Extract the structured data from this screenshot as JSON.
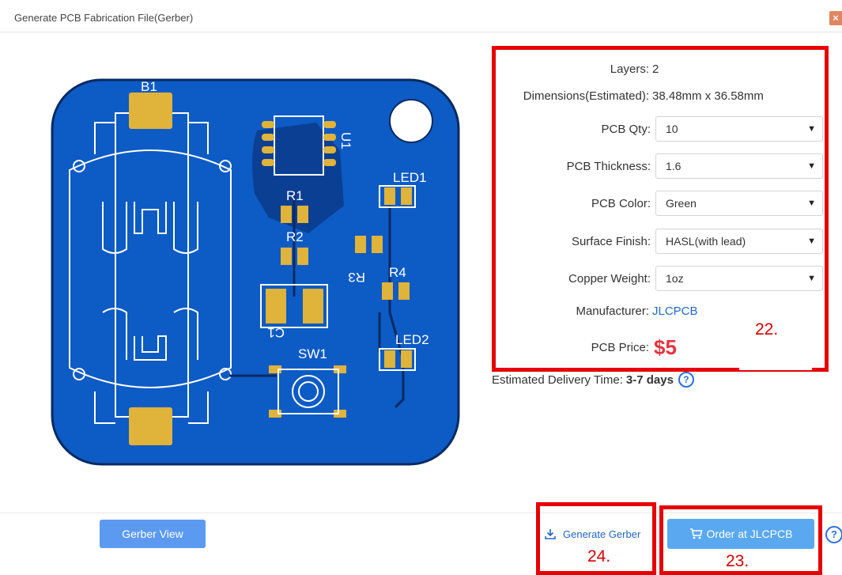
{
  "dialog": {
    "title": "Generate PCB Fabrication File(Gerber)",
    "close_symbol": "×"
  },
  "pcb_preview": {
    "labels": [
      "B1",
      "U1",
      "LED1",
      "R1",
      "R2",
      "R3",
      "R4",
      "C1",
      "SW1",
      "LED2"
    ],
    "board_color": "#0d5bc4",
    "pad_color": "#e0b33a"
  },
  "info": {
    "layers_label": "Layers:",
    "layers_value": "2",
    "dimensions_label": "Dimensions(Estimated):",
    "dimensions_value": "38.48mm x 36.58mm",
    "qty_label": "PCB Qty:",
    "qty_value": "10",
    "thickness_label": "PCB Thickness:",
    "thickness_value": "1.6",
    "color_label": "PCB Color:",
    "color_value": "Green",
    "finish_label": "Surface Finish:",
    "finish_value": "HASL(with lead)",
    "copper_label": "Copper Weight:",
    "copper_value": "1oz",
    "manufacturer_label": "Manufacturer:",
    "manufacturer_value": "JLCPCB",
    "price_label": "PCB Price:",
    "price_value": "$5",
    "caret": "▼"
  },
  "delivery": {
    "label": "Estimated Delivery Time:",
    "value": "3-7 days",
    "help": "?"
  },
  "footer": {
    "gerber_view": "Gerber View",
    "generate_gerber": "Generate Gerber",
    "order": "Order at JLCPCB",
    "help": "?"
  },
  "annotations": {
    "a22": "22.",
    "a23": "23.",
    "a24": "24."
  },
  "colors": {
    "annotation_red": "#e60000",
    "price_red": "#e4343e",
    "link_blue": "#2367c4"
  }
}
